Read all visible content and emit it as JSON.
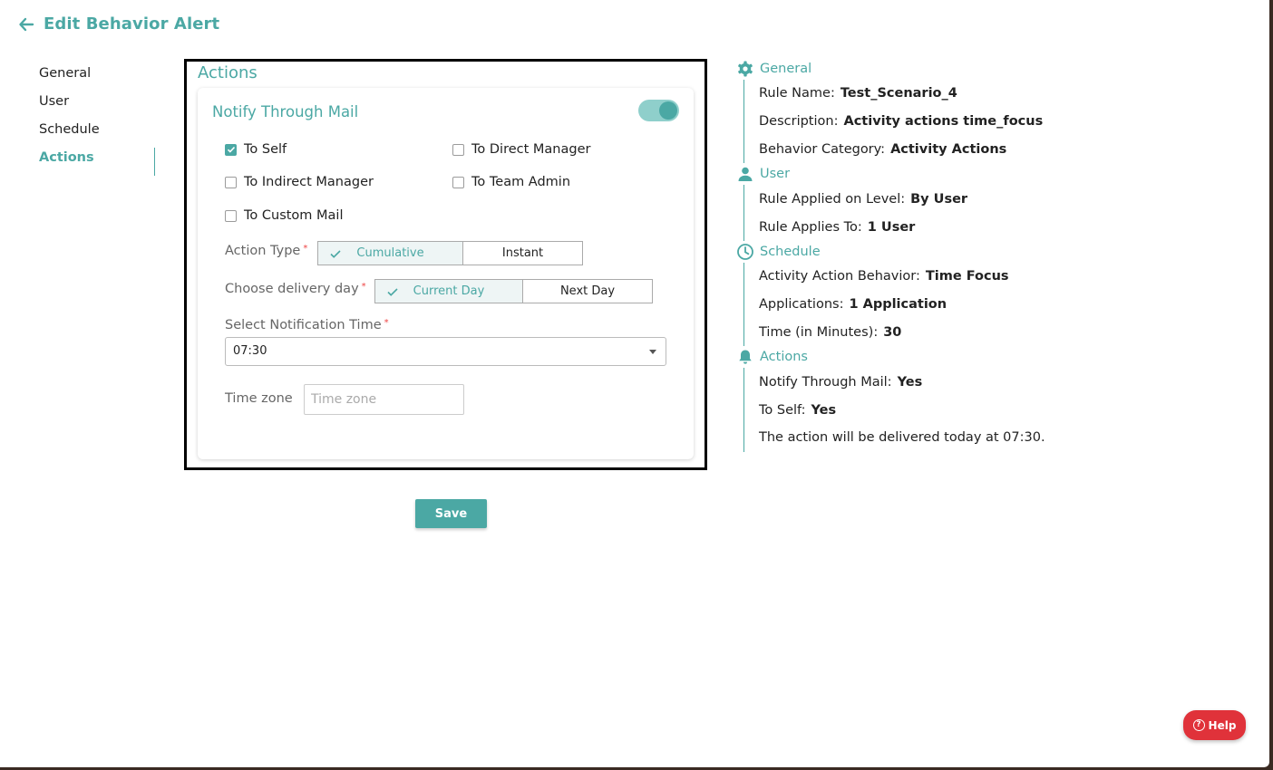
{
  "header": {
    "title": "Edit Behavior Alert",
    "back_icon": "arrow-left-icon"
  },
  "nav": {
    "items": [
      {
        "label": "General",
        "active": false
      },
      {
        "label": "User",
        "active": false
      },
      {
        "label": "Schedule",
        "active": false
      },
      {
        "label": "Actions",
        "active": true
      }
    ]
  },
  "actions": {
    "heading": "Actions",
    "card_title": "Notify Through Mail",
    "notify_enabled": true,
    "checkboxes": [
      {
        "label": "To Self",
        "checked": true
      },
      {
        "label": "To Direct Manager",
        "checked": false
      },
      {
        "label": "To Indirect Manager",
        "checked": false
      },
      {
        "label": "To Team Admin",
        "checked": false
      },
      {
        "label": "To Custom Mail",
        "checked": false
      }
    ],
    "action_type": {
      "label": "Action Type",
      "required": "*",
      "options": [
        "Cumulative",
        "Instant"
      ],
      "selected": "Cumulative"
    },
    "delivery_day": {
      "label": "Choose delivery day",
      "required": "*",
      "options": [
        "Current Day",
        "Next Day"
      ],
      "selected": "Current Day"
    },
    "notification_time": {
      "label": "Select Notification Time",
      "required": "*",
      "value": "07:30"
    },
    "timezone": {
      "label": "Time zone",
      "placeholder": "Time zone",
      "value": ""
    },
    "save_label": "Save"
  },
  "summary": {
    "general": {
      "title": "General",
      "icon": "gear-icon",
      "lines": [
        {
          "label": "Rule Name:",
          "value": "Test_Scenario_4"
        },
        {
          "label": "Description:",
          "value": "Activity actions time_focus"
        },
        {
          "label": "Behavior Category:",
          "value": "Activity Actions"
        }
      ]
    },
    "user": {
      "title": "User",
      "icon": "person-icon",
      "lines": [
        {
          "label": "Rule Applied on Level:",
          "value": "By User"
        },
        {
          "label": "Rule Applies To:",
          "value": "1 User"
        }
      ]
    },
    "schedule": {
      "title": "Schedule",
      "icon": "clock-icon",
      "lines": [
        {
          "label": "Activity Action Behavior:",
          "value": "Time Focus"
        },
        {
          "label": "Applications:",
          "value": "1 Application"
        },
        {
          "label": "Time (in Minutes):",
          "value": "30"
        }
      ]
    },
    "actions": {
      "title": "Actions",
      "icon": "bell-icon",
      "lines": [
        {
          "label": "Notify Through Mail:",
          "value": "Yes"
        },
        {
          "label": "To Self:",
          "value": "Yes"
        }
      ],
      "note": "The action will be delivered today at 07:30."
    }
  },
  "help": {
    "label": "Help",
    "icon": "question-circle-icon"
  },
  "colors": {
    "accent": "#4ba8a4",
    "help": "#e0323a",
    "required": "#ee4444"
  }
}
